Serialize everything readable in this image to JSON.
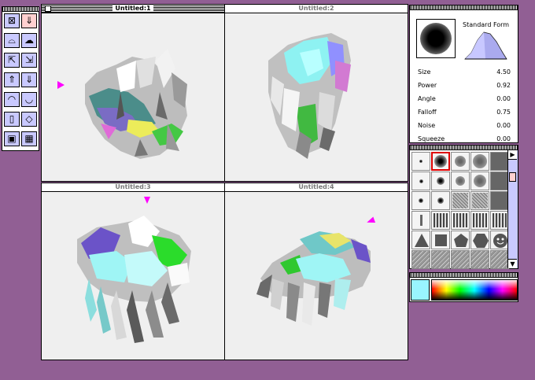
{
  "windows": [
    {
      "title": "Untitled:1",
      "active": true
    },
    {
      "title": "Untitled:2",
      "active": false
    },
    {
      "title": "Untitled:3",
      "active": false
    },
    {
      "title": "Untitled:4",
      "active": false
    }
  ],
  "tools": [
    "brush-tool-icon",
    "paint-drip-icon",
    "smooth-tool-icon",
    "inflate-tool-icon",
    "push-out-icon",
    "push-in-icon",
    "pull-up-icon",
    "push-down-icon",
    "fan-out-icon",
    "fan-in-icon",
    "cylinder-icon",
    "cone-icon",
    "cube-icon",
    "box-icon"
  ],
  "brush_settings": {
    "form_label": "Standard Form",
    "params": [
      {
        "label": "Size",
        "value": "4.50"
      },
      {
        "label": "Power",
        "value": "0.92"
      },
      {
        "label": "Angle",
        "value": "0.00"
      },
      {
        "label": "Falloff",
        "value": "0.75"
      },
      {
        "label": "Noise",
        "value": "0.00"
      },
      {
        "label": "Squeeze",
        "value": "0.00"
      }
    ]
  },
  "brush_library": {
    "selected_index": 1,
    "scroll_right_label": "▶",
    "scroll_down_label": "▼"
  },
  "colors": {
    "desktop": "#915f94",
    "current_color": "#99f5ff",
    "accent_marker": "#ff00ff",
    "palette_fill": "#c9c9ff"
  }
}
